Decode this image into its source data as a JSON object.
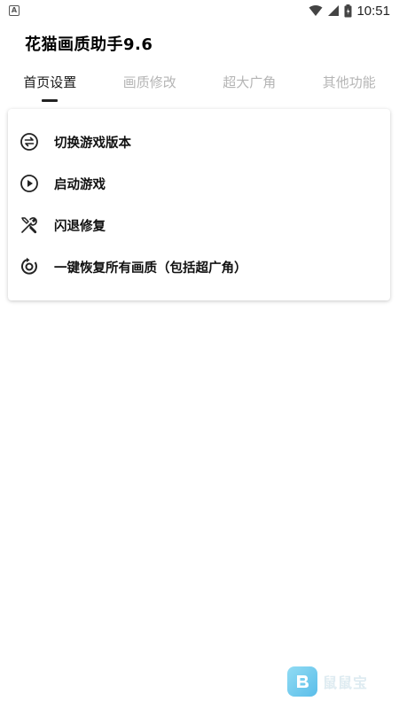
{
  "status_bar": {
    "time": "10:51",
    "left_badge": "A"
  },
  "app": {
    "title": "花猫画质助手9.6"
  },
  "tabs": [
    {
      "label": "首页设置",
      "active": true
    },
    {
      "label": "画质修改",
      "active": false
    },
    {
      "label": "超大广角",
      "active": false
    },
    {
      "label": "其他功能",
      "active": false
    }
  ],
  "menu": [
    {
      "label": "切换游戏版本",
      "icon": "swap-icon"
    },
    {
      "label": "启动游戏",
      "icon": "play-icon"
    },
    {
      "label": "闪退修复",
      "icon": "tools-icon"
    },
    {
      "label": "一键恢复所有画质（包括超广角）",
      "icon": "restore-icon"
    }
  ],
  "watermark": {
    "text": "鼠鼠宝"
  },
  "colors": {
    "tab_inactive": "#b5b5b5",
    "tab_active": "#1a1a1a",
    "watermark_accent": "#3db2e6"
  }
}
